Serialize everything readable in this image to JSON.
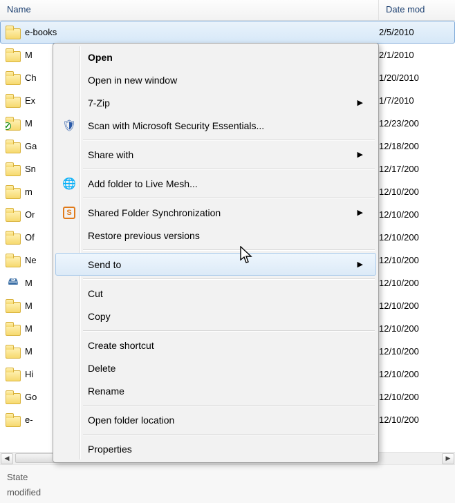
{
  "columns": {
    "name": "Name",
    "date": "Date mod"
  },
  "rows": [
    {
      "name": "e-books",
      "date": "2/5/2010",
      "icon": "folder",
      "selected": true
    },
    {
      "name": "M",
      "date": "2/1/2010",
      "icon": "folder"
    },
    {
      "name": "Ch",
      "date": "1/20/2010",
      "icon": "folder"
    },
    {
      "name": "Ex",
      "date": "1/7/2010",
      "icon": "folder"
    },
    {
      "name": "M",
      "date": "12/23/200",
      "icon": "security"
    },
    {
      "name": "Ga",
      "date": "12/18/200",
      "icon": "folder"
    },
    {
      "name": "Sn",
      "date": "12/17/200",
      "icon": "folder"
    },
    {
      "name": "m",
      "date": "12/10/200",
      "icon": "folder"
    },
    {
      "name": "Or",
      "date": "12/10/200",
      "icon": "folder"
    },
    {
      "name": "Of",
      "date": "12/10/200",
      "icon": "folder"
    },
    {
      "name": "Ne",
      "date": "12/10/200",
      "icon": "folder"
    },
    {
      "name": "M",
      "date": "12/10/200",
      "icon": "hdd"
    },
    {
      "name": "M",
      "date": "12/10/200",
      "icon": "folder"
    },
    {
      "name": "M",
      "date": "12/10/200",
      "icon": "folder"
    },
    {
      "name": "M",
      "date": "12/10/200",
      "icon": "folder"
    },
    {
      "name": "Hi",
      "date": "12/10/200",
      "icon": "folder"
    },
    {
      "name": "Go",
      "date": "12/10/200",
      "icon": "folder"
    },
    {
      "name": "e-",
      "date": "12/10/200",
      "icon": "folder"
    }
  ],
  "status": {
    "line1": "State",
    "line2": "modified"
  },
  "menu": {
    "hoverIndex": 8,
    "items": [
      {
        "label": "Open",
        "bold": true
      },
      {
        "label": "Open in new window"
      },
      {
        "label": "7-Zip",
        "submenu": true
      },
      {
        "label": "Scan with Microsoft Security Essentials...",
        "icon": "shield"
      },
      {
        "sep": true
      },
      {
        "label": "Share with",
        "submenu": true
      },
      {
        "sep": true
      },
      {
        "label": "Add folder to Live Mesh...",
        "icon": "mesh"
      },
      {
        "sep": true
      },
      {
        "label": "Shared Folder Synchronization",
        "submenu": true,
        "icon": "sync"
      },
      {
        "label": "Restore previous versions"
      },
      {
        "sep": true
      },
      {
        "label": "Send to",
        "submenu": true
      },
      {
        "sep": true
      },
      {
        "label": "Cut"
      },
      {
        "label": "Copy"
      },
      {
        "sep": true
      },
      {
        "label": "Create shortcut"
      },
      {
        "label": "Delete"
      },
      {
        "label": "Rename"
      },
      {
        "sep": true
      },
      {
        "label": "Open folder location"
      },
      {
        "sep": true
      },
      {
        "label": "Properties"
      }
    ]
  }
}
